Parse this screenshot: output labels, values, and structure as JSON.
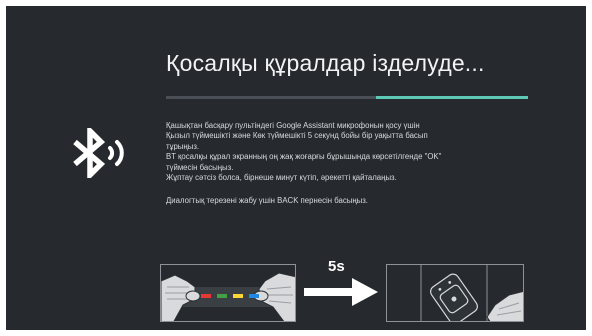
{
  "dialog": {
    "title": "Қосалқы құралдар ізделуде...",
    "progress": 0.42,
    "instructions": [
      "Қашықтан басқару пультіндегі Google Assistant микрофонын қосу үшін",
      "Қызыл түймешікті және Көк түймешікті 5 секунд бойы бір уақытта басып",
      "тұрыңыз.",
      "BT қосалқы құрал экранның оң жақ жоғарғы бұрышында көрсетілгенде \"OK\"",
      "түймесін басыңыз.",
      "Жұптау сәтсіз болса, бірнеше минут күтіп, әрекетті қайталаңыз."
    ],
    "back_hint": "Диалогтық терезені жабу үшін BACK пернесін басыңыз.",
    "illustration": {
      "duration_label": "5s",
      "button_colors": [
        "#e53935",
        "#43a047",
        "#fdd835",
        "#1e88e5"
      ]
    }
  },
  "colors": {
    "background": "#262a2e",
    "accent": "#5cc9b5",
    "track": "#4a4f55"
  },
  "icons": {
    "status": "bluetooth-searching-icon",
    "arrow": "right-arrow-icon"
  }
}
